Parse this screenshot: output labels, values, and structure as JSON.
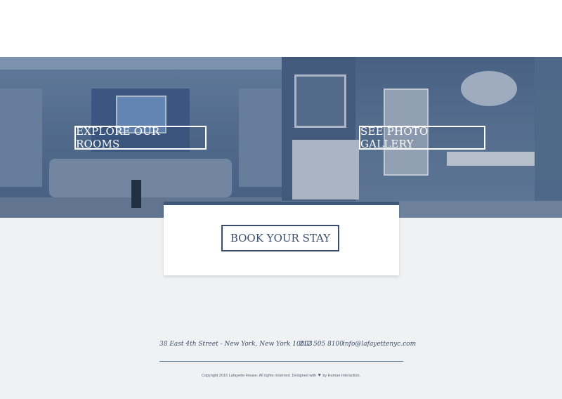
{
  "hero": {
    "explore_rooms_label": "EXPLORE OUR ROOMS",
    "photo_gallery_label": "SEE PHOTO GALLERY"
  },
  "booking": {
    "book_label": "BOOK YOUR STAY"
  },
  "footer": {
    "address": "38 East 4th Street  -  New York, New York 10003",
    "phone": "212 505 8100",
    "email": "info@lafayettenyc.com",
    "copyright_text": "Copyright 2016 Lafayette House. All rights reserved. Designed with",
    "heart_icon": "heart-icon",
    "designer_prefix": "by",
    "designer_link": "Human Interaction."
  },
  "colors": {
    "accent": "#3f587a",
    "page_bg": "#f0f1f3",
    "overlay_blue": "#5a7394"
  }
}
